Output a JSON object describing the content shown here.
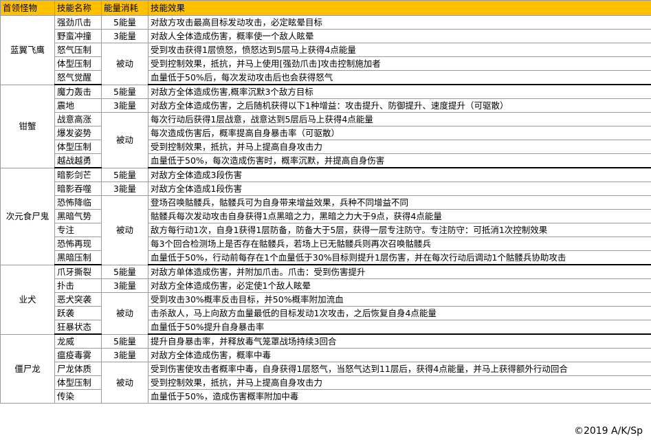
{
  "headers": [
    "首领怪物",
    "技能名称",
    "能量消耗",
    "技能效果"
  ],
  "copyright": "©2019 A/K/Sp",
  "header_color": "#ffc000",
  "bosses": [
    {
      "name": "蓝翼飞鹰",
      "passive_label": "被动",
      "skills": [
        {
          "name": "强劲爪击",
          "cost": "5能量",
          "effect": "对敌方攻击最高目标发动攻击，必定眩晕目标"
        },
        {
          "name": "野蛮冲撞",
          "cost": "3能量",
          "effect": "对敌人全体造成伤害，概率使一个敌人眩晕"
        },
        {
          "name": "怒气压制",
          "effect": "受到攻击获得1层愤怒，愤怒达到5层马上获得4点能量"
        },
        {
          "name": "体型压制",
          "effect": "受到控制效果，抵抗，并马上使用[强劲爪击]攻击控制施加者"
        },
        {
          "name": "怒气觉醒",
          "effect": "血量低于50%后，每次发动攻击后也会获得怒气"
        }
      ]
    },
    {
      "name": "钳蟹",
      "passive_label": "被动",
      "skills": [
        {
          "name": "魔力轰击",
          "cost": "5能量",
          "effect": "对敌方全体造成伤害,概率沉默3个敌方目标"
        },
        {
          "name": "震地",
          "cost": "3能量",
          "effect": "对敌方全体造成伤害，之后随机获得以下1种增益：攻击提升、防御提升、速度提升（可驱散）"
        },
        {
          "name": "战意高涨",
          "effect": "每次行动后获得1层战意，战意达到5层后马上获得4点能量"
        },
        {
          "name": "爆发姿势",
          "effect": "每次造成伤害后，概率提高自身暴击率（可驱散）"
        },
        {
          "name": "体型压制",
          "effect": "受到控制效果，抵抗，并马上提高自身攻击力"
        },
        {
          "name": "越战越勇",
          "effect": "血量低于50%，每次造成伤害时，概率沉默，并提高自身伤害"
        }
      ]
    },
    {
      "name": "次元食尸鬼",
      "passive_label": "被动",
      "skills": [
        {
          "name": "暗影剑芒",
          "cost": "5能量",
          "effect": "对敌方全体造成3段伤害"
        },
        {
          "name": "暗影吞噬",
          "cost": "3能量",
          "effect": "对敌方全体造成1段伤害"
        },
        {
          "name": "恐怖降临",
          "effect": "登场召唤骷髅兵，骷髅兵可为自身带来增益效果，兵种不同增益不同"
        },
        {
          "name": "黑暗气势",
          "effect": "骷髅兵每次发动攻击自身获得1点黑暗之力，黑暗之力大于9点，获得4点能量"
        },
        {
          "name": "专注",
          "effect": "敌方每行动1次，自身1获得1层防备，防备大于5层，获得一层专注防守。专注防守：可抵消1次控制效果"
        },
        {
          "name": "恐怖再现",
          "effect": "每3个回合检测场上是否存在骷髅兵，若场上已无骷髅兵则再次召唤骷髅兵"
        },
        {
          "name": "黑暗压制",
          "effect": "血量低于50%，行动前每存在1个血量低于30%目标则提升1层伤害，并在每次行动后调动1个骷髅兵协助攻击"
        }
      ]
    },
    {
      "name": "业犬",
      "passive_label": "被动",
      "skills": [
        {
          "name": "爪牙撕裂",
          "cost": "5能量",
          "effect": "对敌方单体造成伤害，并附加爪击。爪击：受到伤害提升"
        },
        {
          "name": "扑击",
          "cost": "3能量",
          "effect": "对敌方全体造成伤害，必定使1个敌人眩晕"
        },
        {
          "name": "恶犬突袭",
          "effect": "受到攻击30%概率反击目标，并50%概率附加流血"
        },
        {
          "name": "跃袭",
          "effect": "击杀敌人，马上向敌方血量最低的目标发动1次攻击，之后恢复自身4点能量"
        },
        {
          "name": "狂暴状态",
          "effect": "血量低于50%提升自身暴击率"
        }
      ]
    },
    {
      "name": "僵尸龙",
      "passive_label": "被动",
      "skills": [
        {
          "name": "龙威",
          "cost": "5能量",
          "effect": "提升自身暴击率，并释放毒气笼罩战场持续3回合"
        },
        {
          "name": "瘟疫毒雾",
          "cost": "3能量",
          "effect": "对敌方全体造成伤害，概率中毒"
        },
        {
          "name": "尸龙体质",
          "effect": "受到伤害使攻击者概率中毒，自身获得1层怒气，当怒气达到11层后，获得4点能量，并马上获得额外行动回合"
        },
        {
          "name": "体型压制",
          "effect": "受到控制效果，抵抗，并马上提高自身攻击力"
        },
        {
          "name": "传染",
          "effect": "血量低于50%，造成伤害概率附加中毒"
        }
      ]
    }
  ]
}
